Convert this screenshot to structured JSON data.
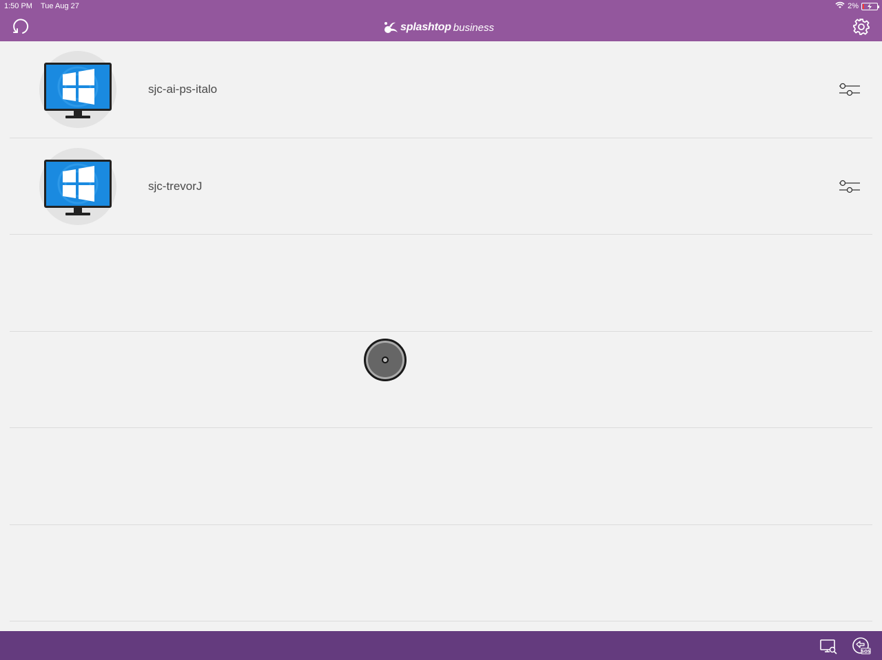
{
  "status_bar": {
    "time": "1:50 PM",
    "date": "Tue Aug 27",
    "battery": "2%",
    "icons": [
      "wifi-icon",
      "battery-icon"
    ]
  },
  "header": {
    "logo_brand": "splashtop",
    "logo_suffix": "business",
    "icons": [
      "refresh-icon",
      "settings-gear-icon"
    ]
  },
  "computers": [
    {
      "name": "sjc-ai-ps-italo",
      "icon": "windows-monitor-icon"
    },
    {
      "name": "sjc-trevorJ",
      "icon": "windows-monitor-icon"
    }
  ],
  "footer": {
    "icons": [
      "computer-search-icon",
      "sos-icon"
    ]
  },
  "colors": {
    "header_bg": "#93579d",
    "footer_bg": "#643b7e",
    "content_bg": "#f2f2f2",
    "windows_blue": "#1a8ae0"
  }
}
